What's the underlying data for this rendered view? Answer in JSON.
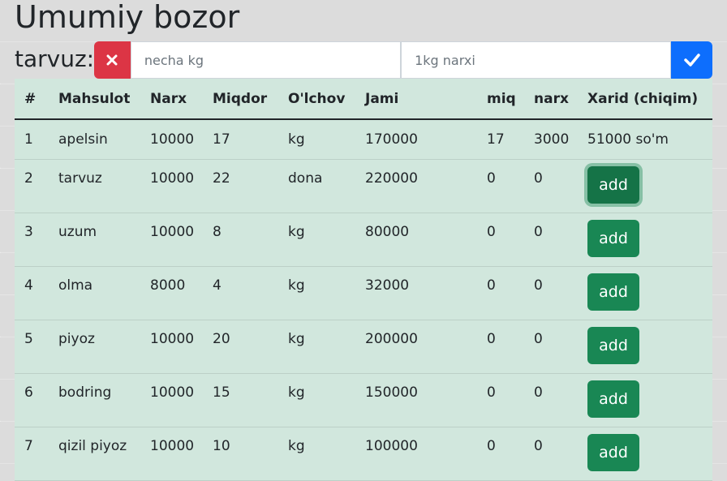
{
  "app": {
    "title": "Umumiy bozor"
  },
  "form": {
    "label": "tarvuz:",
    "kg_placeholder": "necha kg",
    "price_placeholder": "1kg narxi",
    "cancel_icon": "close-icon",
    "confirm_icon": "check-icon"
  },
  "table": {
    "headers": [
      "#",
      "Mahsulot",
      "Narx",
      "Miqdor",
      "O'lchov",
      "Jami",
      "miq",
      "narx",
      "Xarid (chiqim)"
    ],
    "rows": [
      {
        "n": "1",
        "name": "apelsin",
        "price": "10000",
        "qty": "17",
        "unit": "kg",
        "total": "170000",
        "miq": "17",
        "narx": "3000",
        "purchase": "51000 so'm"
      },
      {
        "n": "2",
        "name": "tarvuz",
        "price": "10000",
        "qty": "22",
        "unit": "dona",
        "total": "220000",
        "miq": "0",
        "narx": "0",
        "purchase": "add"
      },
      {
        "n": "3",
        "name": "uzum",
        "price": "10000",
        "qty": "8",
        "unit": "kg",
        "total": "80000",
        "miq": "0",
        "narx": "0",
        "purchase": "add"
      },
      {
        "n": "4",
        "name": "olma",
        "price": "8000",
        "qty": "4",
        "unit": "kg",
        "total": "32000",
        "miq": "0",
        "narx": "0",
        "purchase": "add"
      },
      {
        "n": "5",
        "name": "piyoz",
        "price": "10000",
        "qty": "20",
        "unit": "kg",
        "total": "200000",
        "miq": "0",
        "narx": "0",
        "purchase": "add"
      },
      {
        "n": "6",
        "name": "bodring",
        "price": "10000",
        "qty": "15",
        "unit": "kg",
        "total": "150000",
        "miq": "0",
        "narx": "0",
        "purchase": "add"
      },
      {
        "n": "7",
        "name": "qizil piyoz",
        "price": "10000",
        "qty": "10",
        "unit": "kg",
        "total": "100000",
        "miq": "0",
        "narx": "0",
        "purchase": "add"
      }
    ]
  },
  "colors": {
    "cancel": "#dc3545",
    "confirm": "#0d6efd",
    "add": "#198754",
    "table_bg": "#d1e7dd"
  }
}
